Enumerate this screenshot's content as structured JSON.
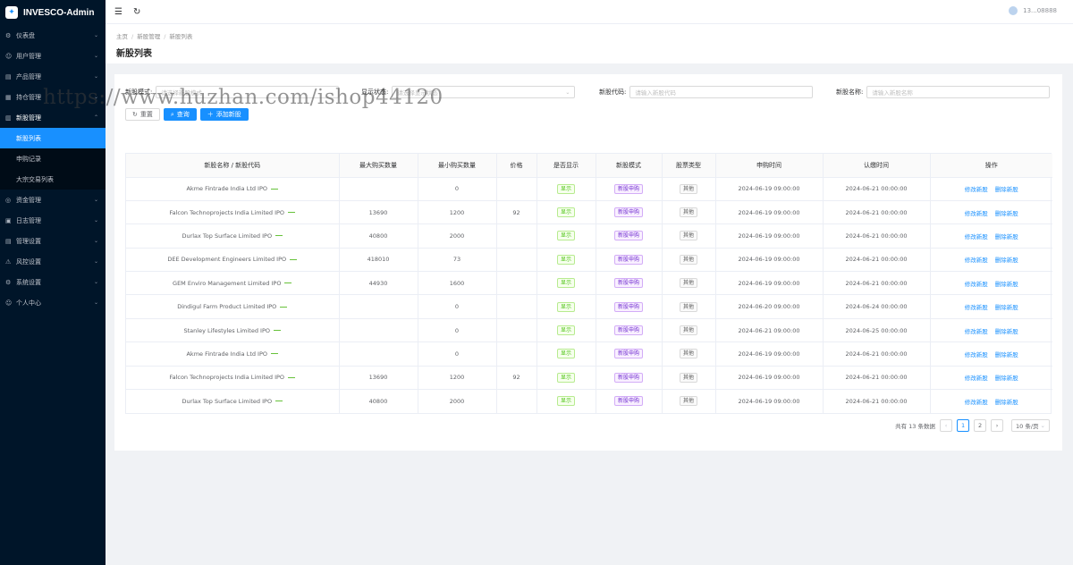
{
  "app": {
    "title": "INVESCO-Admin"
  },
  "header": {
    "user_text": "13...08888"
  },
  "sidebar": {
    "items": [
      {
        "label": "仪表盘",
        "icon": "dashboard-icon",
        "glyph": "⚙"
      },
      {
        "label": "用户管理",
        "icon": "users-icon",
        "glyph": "☺"
      },
      {
        "label": "产品管理",
        "icon": "product-icon",
        "glyph": "▤"
      },
      {
        "label": "持仓管理",
        "icon": "position-icon",
        "glyph": "▦"
      },
      {
        "label": "新股管理",
        "icon": "ipo-icon",
        "glyph": "▥",
        "open": true,
        "children": [
          {
            "label": "新股列表",
            "active": true
          },
          {
            "label": "申购记录"
          },
          {
            "label": "大宗交易列表"
          }
        ]
      },
      {
        "label": "资金管理",
        "icon": "funds-icon",
        "glyph": "◎"
      },
      {
        "label": "日志管理",
        "icon": "log-icon",
        "glyph": "▣"
      },
      {
        "label": "管理设置",
        "icon": "admin-settings-icon",
        "glyph": "▤"
      },
      {
        "label": "风控设置",
        "icon": "risk-icon",
        "glyph": "⚠"
      },
      {
        "label": "系统设置",
        "icon": "system-icon",
        "glyph": "⚙"
      },
      {
        "label": "个人中心",
        "icon": "profile-icon",
        "glyph": "☺"
      }
    ]
  },
  "breadcrumb": [
    "主页",
    "新股管理",
    "新股列表"
  ],
  "page_title": "新股列表",
  "filters": {
    "mode_label": "新股模式:",
    "mode_placeholder": "请选择新股模式",
    "display_label": "显示状态:",
    "display_placeholder": "请选择显示状态",
    "code_label": "新股代码:",
    "code_placeholder": "请输入新股代码",
    "name_label": "新股名称:",
    "name_placeholder": "请输入新股名称"
  },
  "buttons": {
    "reset": "重置",
    "query": "查询",
    "add": "添加新股"
  },
  "table": {
    "columns": [
      "新股名称 / 新股代码",
      "最大购买数量",
      "最小购买数量",
      "价格",
      "是否显示",
      "新股模式",
      "股票类型",
      "申购时间",
      "认缴时间",
      "操作"
    ],
    "rows": [
      {
        "name": "Akme Fintrade India Ltd IPO",
        "max": "",
        "min": "0",
        "price": "",
        "show": "显示",
        "mode": "新股申购",
        "type": "其他",
        "apply": "2024-06-19 09:00:00",
        "subscribe": "2024-06-21 00:00:00"
      },
      {
        "name": "Falcon Technoprojects India Limited IPO",
        "max": "13690",
        "min": "1200",
        "price": "92",
        "show": "显示",
        "mode": "新股申购",
        "type": "其他",
        "apply": "2024-06-19 09:00:00",
        "subscribe": "2024-06-21 00:00:00"
      },
      {
        "name": "Durlax Top Surface Limited IPO",
        "max": "40800",
        "min": "2000",
        "price": "",
        "show": "显示",
        "mode": "新股申购",
        "type": "其他",
        "apply": "2024-06-19 09:00:00",
        "subscribe": "2024-06-21 00:00:00"
      },
      {
        "name": "DEE Development Engineers Limited IPO",
        "max": "418010",
        "min": "73",
        "price": "",
        "show": "显示",
        "mode": "新股申购",
        "type": "其他",
        "apply": "2024-06-19 09:00:00",
        "subscribe": "2024-06-21 00:00:00"
      },
      {
        "name": "GEM Enviro Management Limited IPO",
        "max": "44930",
        "min": "1600",
        "price": "",
        "show": "显示",
        "mode": "新股申购",
        "type": "其他",
        "apply": "2024-06-19 09:00:00",
        "subscribe": "2024-06-21 00:00:00"
      },
      {
        "name": "Dindigul Farm Product Limited IPO",
        "max": "",
        "min": "0",
        "price": "",
        "show": "显示",
        "mode": "新股申购",
        "type": "其他",
        "apply": "2024-06-20 09:00:00",
        "subscribe": "2024-06-24 00:00:00"
      },
      {
        "name": "Stanley Lifestyles Limited IPO",
        "max": "",
        "min": "0",
        "price": "",
        "show": "显示",
        "mode": "新股申购",
        "type": "其他",
        "apply": "2024-06-21 09:00:00",
        "subscribe": "2024-06-25 00:00:00"
      },
      {
        "name": "Akme Fintrade India Ltd IPO",
        "max": "",
        "min": "0",
        "price": "",
        "show": "显示",
        "mode": "新股申购",
        "type": "其他",
        "apply": "2024-06-19 09:00:00",
        "subscribe": "2024-06-21 00:00:00"
      },
      {
        "name": "Falcon Technoprojects India Limited IPO",
        "max": "13690",
        "min": "1200",
        "price": "92",
        "show": "显示",
        "mode": "新股申购",
        "type": "其他",
        "apply": "2024-06-19 09:00:00",
        "subscribe": "2024-06-21 00:00:00"
      },
      {
        "name": "Durlax Top Surface Limited IPO",
        "max": "40800",
        "min": "2000",
        "price": "",
        "show": "显示",
        "mode": "新股申购",
        "type": "其他",
        "apply": "2024-06-19 09:00:00",
        "subscribe": "2024-06-21 00:00:00"
      }
    ],
    "edit_label": "修改新股",
    "delete_label": "删除新股"
  },
  "pagination": {
    "total_text": "共有 13 条数据",
    "pages": [
      "1",
      "2"
    ],
    "current": "1",
    "page_size": "10 条/页"
  },
  "watermark": "https://www.huzhan.com/ishop44120",
  "colors": {
    "sidebar_bg": "#001529",
    "primary": "#1890ff",
    "tag_green": "#52c41a",
    "tag_purple": "#722ed1"
  }
}
